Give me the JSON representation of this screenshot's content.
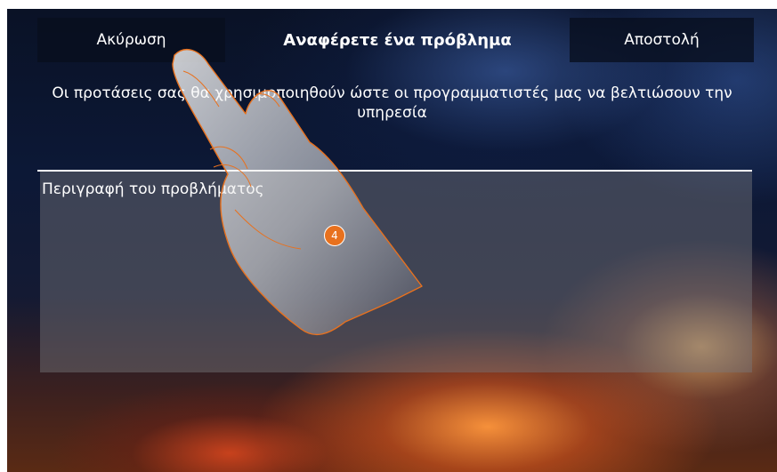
{
  "header": {
    "cancel_label": "Ακύρωση",
    "title": "Αναφέρετε ένα πρόβλημα",
    "send_label": "Αποστολή"
  },
  "info": {
    "line1": "Οι προτάσεις σας θα χρησιμοποιηθούν ώστε οι προγραμματιστές μας να βελτιώσουν την",
    "line2": "υπηρεσία"
  },
  "description_field": {
    "placeholder": "Περιγραφή του προβλήματος"
  },
  "step_badge": {
    "number": "4",
    "color": "#e8711e"
  },
  "colors": {
    "accent": "#e8711e",
    "text": "#ffffff",
    "button_bg": "#080e1e"
  }
}
